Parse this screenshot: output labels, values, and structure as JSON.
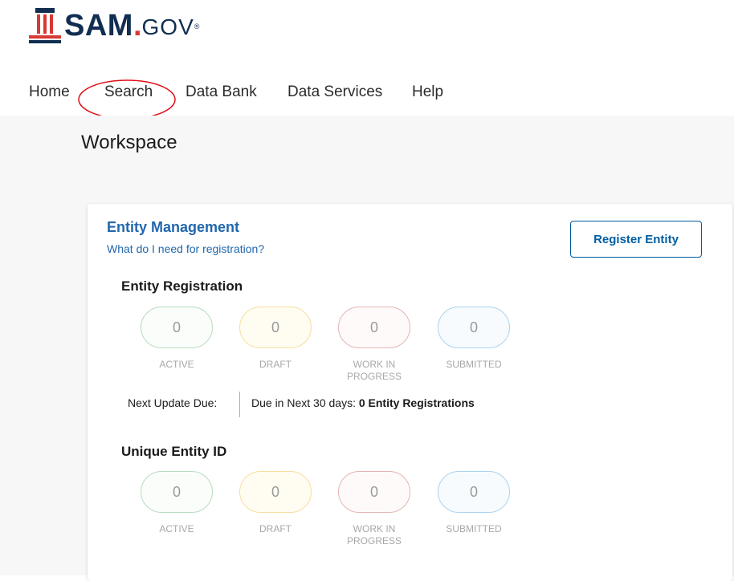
{
  "brand": {
    "logo_main": "SAM",
    "logo_dot": ".",
    "logo_suffix": "GOV",
    "logo_reg": "®"
  },
  "nav": {
    "items": [
      "Home",
      "Search",
      "Data Bank",
      "Data Services",
      "Help"
    ]
  },
  "page": {
    "title": "Workspace"
  },
  "entity_management": {
    "title": "Entity Management",
    "help_link": "What do I need for registration?",
    "register_button": "Register Entity",
    "registration": {
      "title": "Entity Registration",
      "counts": {
        "active": "0",
        "draft": "0",
        "work_in_progress": "0",
        "submitted": "0"
      },
      "labels": {
        "active": "ACTIVE",
        "draft": "DRAFT",
        "wip_line1": "WORK IN",
        "wip_line2": "PROGRESS",
        "submitted": "SUBMITTED"
      }
    },
    "next_update": {
      "label": "Next Update Due:",
      "prefix": "Due in Next 30 days: ",
      "value": "0 Entity Registrations"
    },
    "uei": {
      "title": "Unique Entity ID",
      "counts": {
        "active": "0",
        "draft": "0",
        "work_in_progress": "0",
        "submitted": "0"
      },
      "labels": {
        "active": "ACTIVE",
        "draft": "DRAFT",
        "wip_line1": "WORK IN",
        "wip_line2": "PROGRESS",
        "submitted": "SUBMITTED"
      }
    }
  },
  "colors": {
    "brand_navy": "#112e51",
    "brand_red": "#d83933",
    "link_blue": "#2167ae",
    "annotation_red": "#e0101a"
  },
  "icons": {
    "logo": "uncle-sam-hat-icon"
  }
}
